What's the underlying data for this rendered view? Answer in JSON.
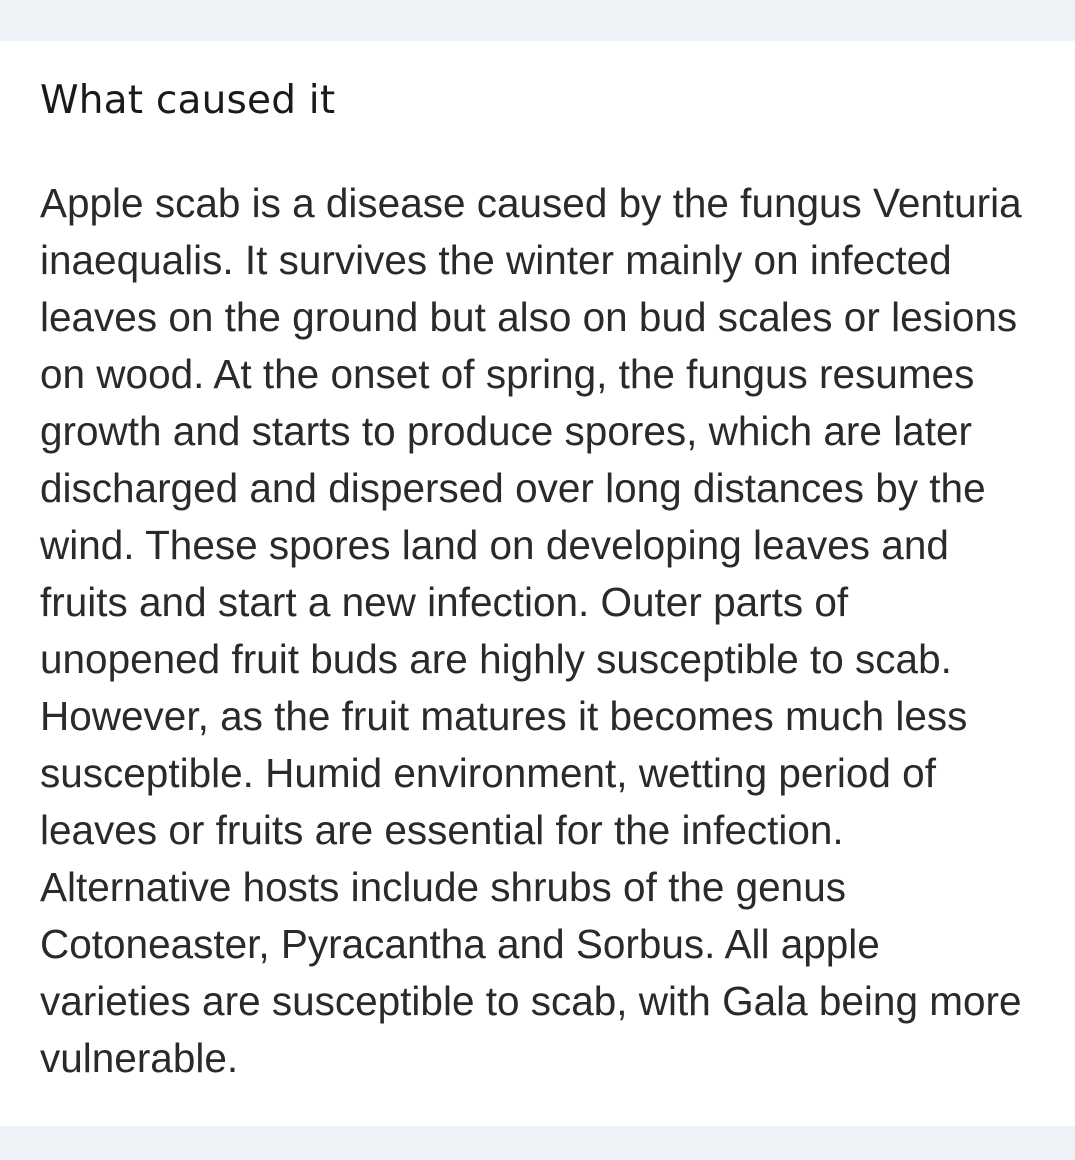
{
  "section": {
    "title": "What caused it",
    "body": "Apple scab is a disease caused by the fungus Venturia inaequalis. It survives the winter mainly on infected leaves on the ground but also on bud scales or lesions on wood. At the onset of spring, the fungus resumes growth and starts to produce spores, which are later discharged and dispersed over long distances by the wind. These spores land on developing leaves and fruits and start a new infection. Outer parts of unopened fruit buds are highly susceptible to scab. However, as the fruit matures it becomes much less susceptible. Humid environment, wetting period of leaves or fruits are essential for the infection. Alternative hosts include shrubs of the genus Cotoneaster, Pyracantha and Sorbus. All apple varieties are susceptible to scab, with Gala being more vulnerable."
  }
}
